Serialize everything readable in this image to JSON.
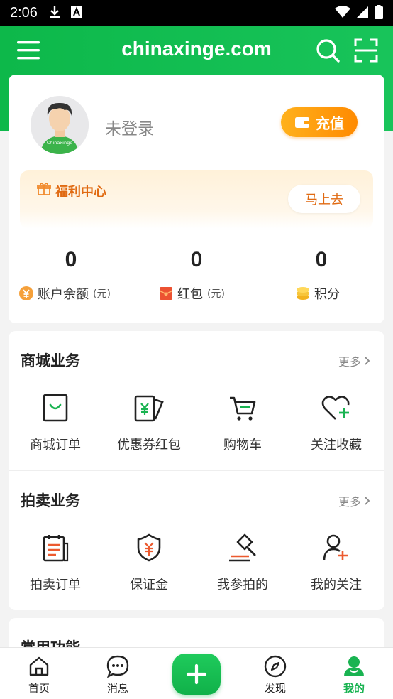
{
  "status_bar": {
    "time": "2:06"
  },
  "app_bar": {
    "title": "chinaxinge.com"
  },
  "profile": {
    "login_text": "未登录",
    "recharge_label": "充值",
    "avatar_badge": "Chinaxinge"
  },
  "welfare": {
    "title": "福利中心",
    "go_label": "马上去"
  },
  "stats": [
    {
      "value": "0",
      "label": "账户余额",
      "unit": "(元)"
    },
    {
      "value": "0",
      "label": "红包",
      "unit": "(元)"
    },
    {
      "value": "0",
      "label": "积分",
      "unit": ""
    }
  ],
  "mall": {
    "title": "商城业务",
    "more": "更多",
    "items": [
      {
        "label": "商城订单",
        "icon": "bag-icon"
      },
      {
        "label": "优惠券红包",
        "icon": "coupon-icon"
      },
      {
        "label": "购物车",
        "icon": "cart-icon"
      },
      {
        "label": "关注收藏",
        "icon": "heart-plus-icon"
      }
    ]
  },
  "auction": {
    "title": "拍卖业务",
    "more": "更多",
    "items": [
      {
        "label": "拍卖订单",
        "icon": "clipboard-icon"
      },
      {
        "label": "保证金",
        "icon": "shield-yuan-icon"
      },
      {
        "label": "我参拍的",
        "icon": "gavel-icon"
      },
      {
        "label": "我的关注",
        "icon": "user-plus-icon"
      }
    ]
  },
  "common": {
    "title": "常用功能"
  },
  "tabbar": {
    "items": [
      {
        "label": "首页",
        "icon": "home-icon"
      },
      {
        "label": "消息",
        "icon": "message-icon"
      },
      {
        "label": "发现",
        "icon": "compass-icon"
      },
      {
        "label": "我的",
        "icon": "profile-icon"
      }
    ]
  },
  "colors": {
    "brand_green": "#19b351",
    "accent_orange": "#ff8a00",
    "red_icon": "#e84a2f"
  }
}
